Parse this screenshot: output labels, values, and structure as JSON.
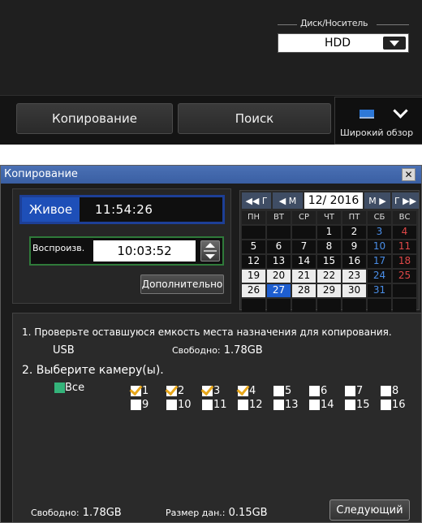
{
  "top_panel": {
    "disk_label": "Диск/Носитель",
    "disk_value": "HDD",
    "tab_copy": "Копирование",
    "tab_search": "Поиск",
    "wide_view_label": "Широкий обзор"
  },
  "dialog": {
    "title": "Копирование",
    "close_label": "✕",
    "live_label": "Живое",
    "live_time": "11:54:26",
    "playback_label": "Воспроизв.",
    "playback_time": "10:03:52",
    "more_label": "Дополнительно",
    "calendar": {
      "nav_prev_year": "◀◀ Г",
      "nav_prev_month": "◀ М",
      "month_year": "12/ 2016",
      "nav_next_month": "М ▶",
      "nav_next_year": "Г ▶▶",
      "weekdays": [
        "ПН",
        "ВТ",
        "СР",
        "ЧТ",
        "ПТ",
        "СБ",
        "ВС"
      ],
      "weeks": [
        [
          "",
          "",
          "",
          "1",
          "2",
          "3",
          "4"
        ],
        [
          "5",
          "6",
          "7",
          "8",
          "9",
          "10",
          "11"
        ],
        [
          "12",
          "13",
          "14",
          "15",
          "16",
          "17",
          "18"
        ],
        [
          "19",
          "20",
          "21",
          "22",
          "23",
          "24",
          "25"
        ],
        [
          "26",
          "27",
          "28",
          "29",
          "30",
          "31",
          ""
        ],
        [
          "",
          "",
          "",
          "",
          "",
          "",
          ""
        ]
      ],
      "recorded_days": [
        "19",
        "20",
        "21",
        "22",
        "23",
        "26",
        "28",
        "29",
        "30"
      ],
      "today": "27"
    },
    "step1": "1. Проверьте оставшуюся емкость места назначения для копирования.",
    "destination": "USB",
    "free_label": "Свободно:",
    "free_value": "1.78GB",
    "step2": "2. Выберите камеру(ы).",
    "all_label": "Все",
    "cameras": [
      {
        "num": "1",
        "checked": true
      },
      {
        "num": "2",
        "checked": true
      },
      {
        "num": "3",
        "checked": true
      },
      {
        "num": "4",
        "checked": true
      },
      {
        "num": "5",
        "checked": false
      },
      {
        "num": "6",
        "checked": false
      },
      {
        "num": "7",
        "checked": false
      },
      {
        "num": "8",
        "checked": false
      },
      {
        "num": "9",
        "checked": false
      },
      {
        "num": "10",
        "checked": false
      },
      {
        "num": "11",
        "checked": false
      },
      {
        "num": "12",
        "checked": false
      },
      {
        "num": "13",
        "checked": false
      },
      {
        "num": "14",
        "checked": false
      },
      {
        "num": "15",
        "checked": false
      },
      {
        "num": "16",
        "checked": false
      }
    ],
    "bottom_free_label": "Свободно:",
    "bottom_free_value": "1.78GB",
    "size_label": "Размер дан.:",
    "size_value": "0.15GB",
    "next_label": "Следующий"
  },
  "colors": {
    "title_bar": "#3a5fa3",
    "live_tag": "#1e4fb8",
    "playback_border": "#2f7a3a",
    "check_mark": "#e8a71a",
    "all_checkbox": "#34b37a",
    "saturday": "#4a8ee8",
    "sunday": "#e04848"
  }
}
